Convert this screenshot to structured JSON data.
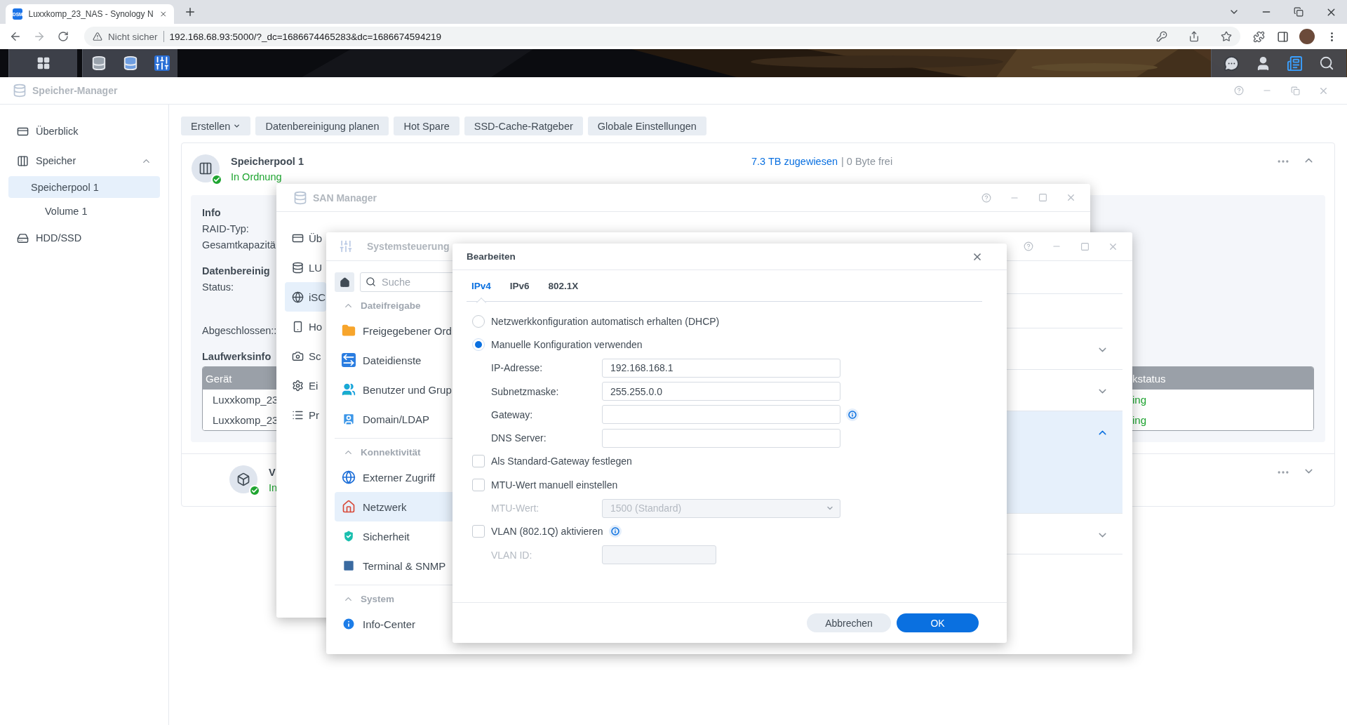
{
  "browser": {
    "tab_favicon": "DSM",
    "tab_title": "Luxxkomp_23_NAS - Synology N",
    "security_label": "Nicht sicher",
    "url": "192.168.68.93:5000/?_dc=1686674465283&dc=1686674594219"
  },
  "storage_manager": {
    "title": "Speicher-Manager",
    "sidebar": [
      {
        "label": "Überblick",
        "selected": false
      },
      {
        "label": "Speicher",
        "selected": false,
        "expanded": true,
        "children": [
          {
            "label": "Speicherpool 1",
            "selected": true,
            "children": [
              {
                "label": "Volume 1",
                "selected": false
              }
            ]
          }
        ]
      },
      {
        "label": "HDD/SSD",
        "selected": false
      }
    ],
    "toolbar": [
      {
        "label": "Erstellen",
        "dropdown": true
      },
      {
        "label": "Datenbereinigung planen",
        "dropdown": false
      },
      {
        "label": "Hot Spare",
        "dropdown": false
      },
      {
        "label": "SSD-Cache-Ratgeber",
        "dropdown": false
      },
      {
        "label": "Globale Einstellungen",
        "dropdown": false
      }
    ],
    "pool": {
      "name": "Speicherpool 1",
      "status": "In Ordnung",
      "allocated": "7.3 TB zugewiesen",
      "free": "| 0 Byte frei",
      "expanded": true,
      "sections": [
        {
          "heading": "Info",
          "labels": [
            "RAID-Typ:",
            "Gesamtkapazitä"
          ]
        },
        {
          "heading": "Datenbereinig",
          "labels": [
            "Status:",
            "Abgeschlossen::"
          ]
        }
      ],
      "drives": {
        "heading": "Laufwerksinfo",
        "columns": [
          "Gerät",
          "kstatus"
        ],
        "rows": [
          [
            "Luxxkomp_23",
            "ing"
          ],
          [
            "Luxxkomp_23",
            "ing"
          ]
        ]
      }
    },
    "volume": {
      "name": "V",
      "status": "In",
      "expanded": false
    }
  },
  "san_manager": {
    "title": "SAN Manager",
    "sidebar": [
      {
        "label": "Üb",
        "selected": false
      },
      {
        "label": "LU",
        "selected": false
      },
      {
        "label": "iSC",
        "selected": true
      },
      {
        "label": "Ho",
        "selected": false
      },
      {
        "label": "Sc",
        "selected": false
      },
      {
        "label": "Ei",
        "selected": false
      },
      {
        "label": "Pr",
        "selected": false
      }
    ]
  },
  "control_panel": {
    "title": "Systemsteuerung",
    "search_placeholder": "Suche",
    "groups": [
      {
        "label": "Dateifreigabe",
        "expanded": true,
        "items": [
          {
            "label": "Freigegebener Ord",
            "selected": false
          },
          {
            "label": "Dateidienste",
            "selected": false
          },
          {
            "label": "Benutzer und Grup",
            "selected": false
          },
          {
            "label": "Domain/LDAP",
            "selected": false
          }
        ]
      },
      {
        "label": "Konnektivität",
        "expanded": true,
        "items": [
          {
            "label": "Externer Zugriff",
            "selected": false
          },
          {
            "label": "Netzwerk",
            "selected": true
          },
          {
            "label": "Sicherheit",
            "selected": false
          },
          {
            "label": "Terminal & SNMP",
            "selected": false
          }
        ]
      },
      {
        "label": "System",
        "expanded": true,
        "items": [
          {
            "label": "Info-Center",
            "selected": false
          }
        ]
      }
    ],
    "rows": [
      {
        "expanded": false,
        "selected": false
      },
      {
        "expanded": false,
        "selected": false
      },
      {
        "expanded": true,
        "selected": true
      },
      {
        "expanded": false,
        "selected": false
      }
    ]
  },
  "dialog": {
    "title": "Bearbeiten",
    "tabs": [
      {
        "label": "IPv4",
        "selected": true
      },
      {
        "label": "IPv6",
        "selected": false
      },
      {
        "label": "802.1X",
        "selected": false
      }
    ],
    "rows": [
      {
        "kind": "radio",
        "label": "Netzwerkkonfiguration automatisch erhalten (DHCP)",
        "selected": false
      },
      {
        "kind": "radio",
        "label": "Manuelle Konfiguration verwenden",
        "selected": true
      },
      {
        "kind": "field",
        "label": "IP-Adresse:",
        "value": "192.168.168.1",
        "disabled": false
      },
      {
        "kind": "field",
        "label": "Subnetzmaske:",
        "value": "255.255.0.0",
        "disabled": false
      },
      {
        "kind": "field",
        "label": "Gateway:",
        "disabled": false,
        "info": true
      },
      {
        "kind": "field",
        "label": "DNS Server:",
        "disabled": false
      },
      {
        "kind": "checkbox",
        "label": "Als Standard-Gateway festlegen",
        "checked": false
      },
      {
        "kind": "checkbox",
        "label": "MTU-Wert manuell einstellen",
        "checked": false
      },
      {
        "kind": "select",
        "label": "MTU-Wert:",
        "value": "1500 (Standard)",
        "disabled": true
      },
      {
        "kind": "checkbox",
        "label": "VLAN (802.1Q) aktivieren",
        "checked": false,
        "info": true
      },
      {
        "kind": "small-field",
        "label": "VLAN ID:",
        "disabled": true
      }
    ],
    "buttons": [
      {
        "label": "Abbrechen",
        "primary": false
      },
      {
        "label": "OK",
        "primary": true
      }
    ]
  }
}
